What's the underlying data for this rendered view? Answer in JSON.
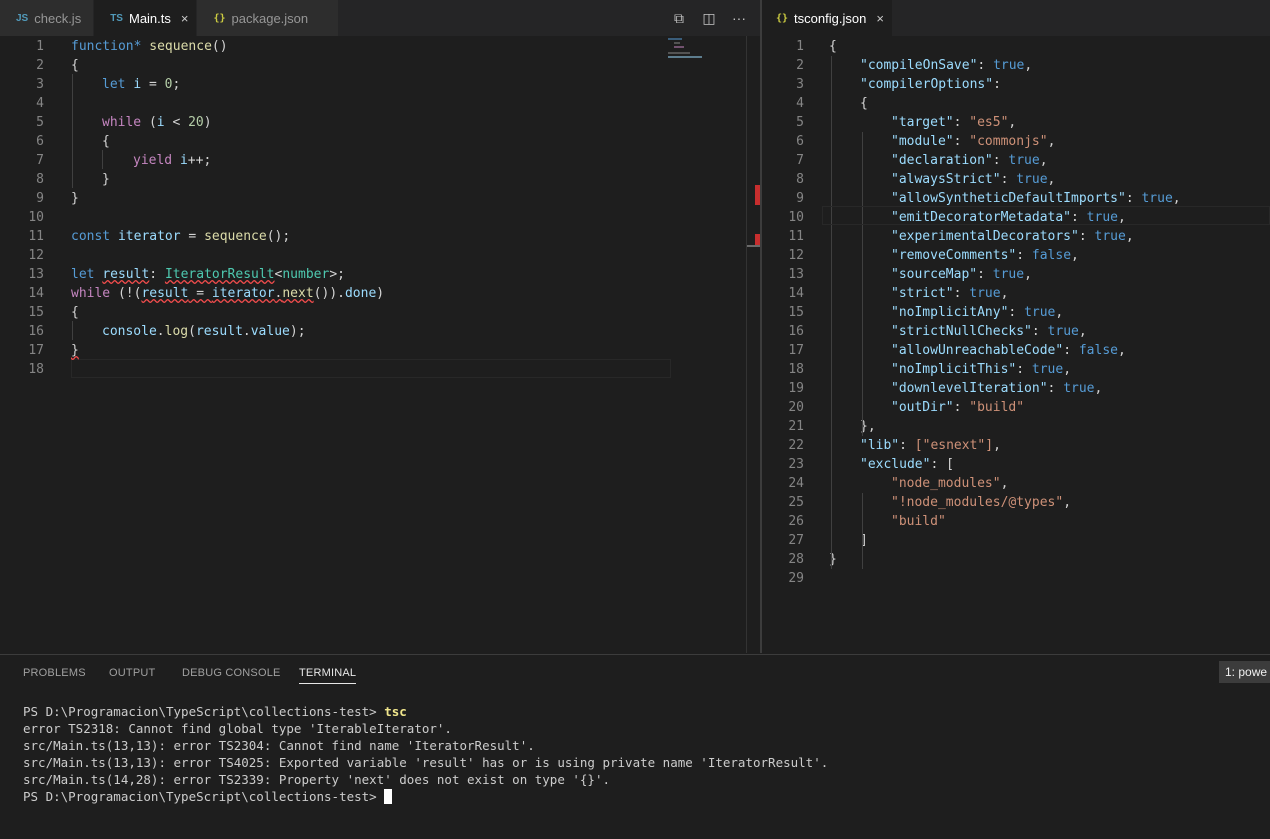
{
  "left_tabs": [
    {
      "icon": "JS",
      "label": "check.js"
    },
    {
      "icon": "TS",
      "label": "Main.ts",
      "close": "×"
    },
    {
      "icon": "{}",
      "label": "package.json"
    }
  ],
  "right_tab": {
    "icon": "{}",
    "label": "tsconfig.json",
    "close": "×"
  },
  "actions": {
    "compare": "⧉",
    "split": "◫",
    "more": "···"
  },
  "left_lines": [
    "1",
    "2",
    "3",
    "4",
    "5",
    "6",
    "7",
    "8",
    "9",
    "10",
    "11",
    "12",
    "13",
    "14",
    "15",
    "16",
    "17",
    "18"
  ],
  "right_lines": [
    "1",
    "2",
    "3",
    "4",
    "5",
    "6",
    "7",
    "8",
    "9",
    "10",
    "11",
    "12",
    "13",
    "14",
    "15",
    "16",
    "17",
    "18",
    "19",
    "20",
    "21",
    "22",
    "23",
    "24",
    "25",
    "26",
    "27",
    "28",
    "29"
  ],
  "main_ts": {
    "l1": {
      "a": "function*",
      "b": " ",
      "c": "sequence",
      "d": "()"
    },
    "l2": "{",
    "l3": {
      "a": "let",
      "b": " ",
      "c": "i",
      "d": " = ",
      "e": "0",
      "f": ";"
    },
    "l5": {
      "a": "while",
      "b": " (",
      "c": "i",
      "d": " < ",
      "e": "20",
      "f": ")"
    },
    "l6": "{",
    "l7": {
      "a": "yield",
      "b": " ",
      "c": "i",
      "d": "++;"
    },
    "l8": "}",
    "l9": "}",
    "l11": {
      "a": "const",
      "b": " ",
      "c": "iterator",
      "d": " = ",
      "e": "sequence",
      "f": "();"
    },
    "l13": {
      "a": "let",
      "b": " ",
      "c": "result",
      "d": ": ",
      "e": "IteratorResult",
      "f": "<",
      "g": "number",
      "h": ">;"
    },
    "l14": {
      "a": "while",
      "b": " (!(",
      "c": "result",
      "d": " = ",
      "e": "iterator",
      "f": ".",
      "g": "next",
      "h": "()).",
      "i": "done",
      "j": ")"
    },
    "l15": "{",
    "l16": {
      "a": "console",
      "b": ".",
      "c": "log",
      "d": "(",
      "e": "result",
      "f": ".",
      "g": "value",
      "h": ");"
    },
    "l17": "}"
  },
  "tsconfig": [
    {
      "k": "",
      "v": "",
      "raw": "{"
    },
    {
      "k": "\"compileOnSave\"",
      "v": "true",
      "vt": "kw",
      "tail": ",",
      "ind": 1
    },
    {
      "k": "\"compilerOptions\"",
      "v": "",
      "tail": ":",
      "ind": 1
    },
    {
      "raw": "{",
      "ind": 1
    },
    {
      "k": "\"target\"",
      "v": "\"es5\"",
      "vt": "str",
      "tail": ",",
      "ind": 2
    },
    {
      "k": "\"module\"",
      "v": "\"commonjs\"",
      "vt": "str",
      "tail": ",",
      "ind": 2
    },
    {
      "k": "\"declaration\"",
      "v": "true",
      "vt": "kw",
      "tail": ",",
      "ind": 2
    },
    {
      "k": "\"alwaysStrict\"",
      "v": "true",
      "vt": "kw",
      "tail": ",",
      "ind": 2
    },
    {
      "k": "\"allowSyntheticDefaultImports\"",
      "v": "true",
      "vt": "kw",
      "tail": ",",
      "ind": 2
    },
    {
      "k": "\"emitDecoratorMetadata\"",
      "v": "true",
      "vt": "kw",
      "tail": ",",
      "ind": 2
    },
    {
      "k": "\"experimentalDecorators\"",
      "v": "true",
      "vt": "kw",
      "tail": ",",
      "ind": 2
    },
    {
      "k": "\"removeComments\"",
      "v": "false",
      "vt": "kw",
      "tail": ",",
      "ind": 2
    },
    {
      "k": "\"sourceMap\"",
      "v": "true",
      "vt": "kw",
      "tail": ",",
      "ind": 2
    },
    {
      "k": "\"strict\"",
      "v": "true",
      "vt": "kw",
      "tail": ",",
      "ind": 2
    },
    {
      "k": "\"noImplicitAny\"",
      "v": "true",
      "vt": "kw",
      "tail": ",",
      "ind": 2
    },
    {
      "k": "\"strictNullChecks\"",
      "v": "true",
      "vt": "kw",
      "tail": ",",
      "ind": 2
    },
    {
      "k": "\"allowUnreachableCode\"",
      "v": "false",
      "vt": "kw",
      "tail": ",",
      "ind": 2
    },
    {
      "k": "\"noImplicitThis\"",
      "v": "true",
      "vt": "kw",
      "tail": ",",
      "ind": 2
    },
    {
      "k": "\"downlevelIteration\"",
      "v": "true",
      "vt": "kw",
      "tail": ",",
      "ind": 2
    },
    {
      "k": "\"outDir\"",
      "v": "\"build\"",
      "vt": "str",
      "tail": "",
      "ind": 2
    },
    {
      "raw": "},",
      "ind": 1
    },
    {
      "k": "\"lib\"",
      "v": "[\"esnext\"]",
      "vt": "arr",
      "tail": ",",
      "ind": 1
    },
    {
      "k": "\"exclude\"",
      "v": "[",
      "vt": "plain",
      "tail": "",
      "ind": 1
    },
    {
      "s": "\"node_modules\"",
      "tail": ",",
      "ind": 2
    },
    {
      "s": "\"!node_modules/@types\"",
      "tail": ",",
      "ind": 2
    },
    {
      "s": "\"build\"",
      "tail": "",
      "ind": 2
    },
    {
      "raw": "]",
      "ind": 1
    },
    {
      "raw": "}",
      "ind": 0
    },
    {
      "raw": "",
      "ind": 0
    }
  ],
  "panel": {
    "tabs": [
      "PROBLEMS",
      "OUTPUT",
      "DEBUG CONSOLE",
      "TERMINAL"
    ],
    "terminal_select": "1: powe",
    "prompt": "PS D:\\Programacion\\TypeScript\\collections-test> ",
    "command": "tsc",
    "output": [
      "error TS2318: Cannot find global type 'IterableIterator'.",
      "src/Main.ts(13,13): error TS2304: Cannot find name 'IteratorResult'.",
      "src/Main.ts(13,13): error TS4025: Exported variable 'result' has or is using private name 'IteratorResult'.",
      "src/Main.ts(14,28): error TS2339: Property 'next' does not exist on type '{}'."
    ],
    "prompt2": "PS D:\\Programacion\\TypeScript\\collections-test> "
  },
  "colors": {
    "editor_bg": "#1e1e1e",
    "keyword": "#569cd6",
    "control": "#c586c0",
    "function": "#dcdcaa",
    "variable": "#9cdcfe",
    "string": "#ce9178",
    "type": "#4ec9b0",
    "error": "#f14c4c"
  }
}
